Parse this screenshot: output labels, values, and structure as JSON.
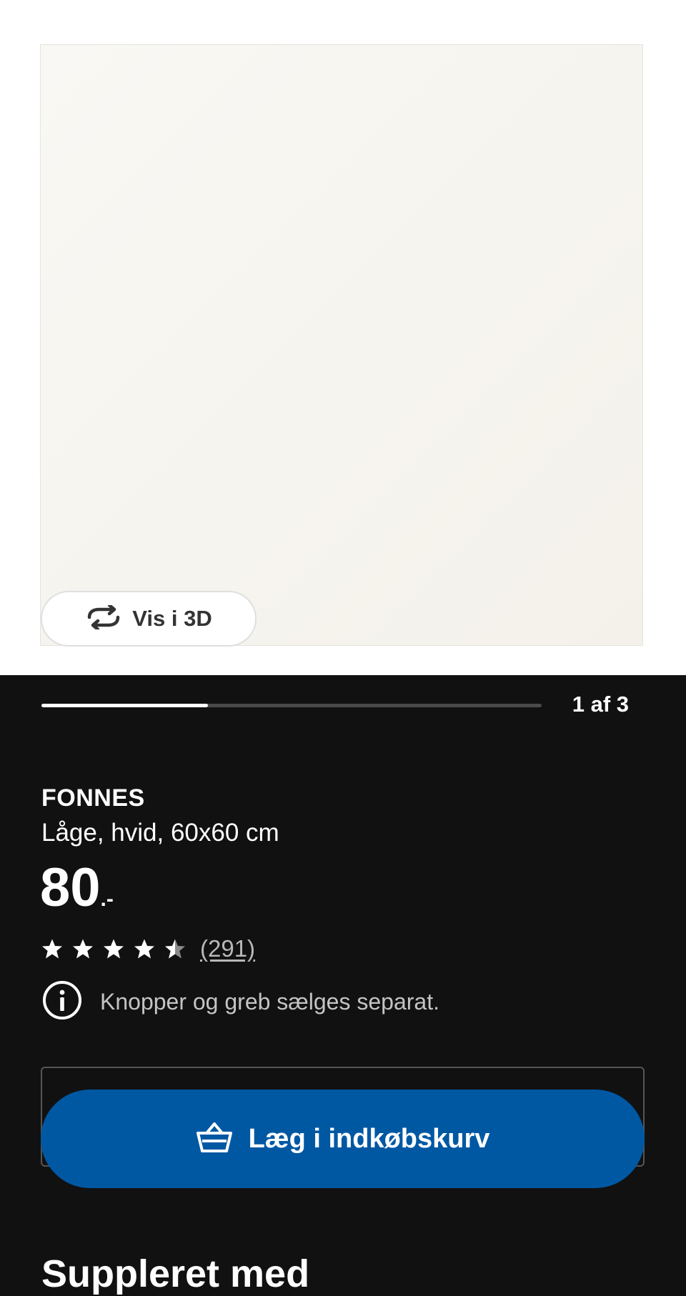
{
  "gallery": {
    "view_3d_label": "Vis i 3D",
    "progress": 0.333,
    "page_counter": "1 af 3"
  },
  "product": {
    "name": "FONNES",
    "description": "Låge, hvid, 60x60 cm",
    "price_integer": "80",
    "price_suffix": ".-",
    "rating": 4.5,
    "rating_max": 5,
    "review_count": "(291)",
    "notice": "Knopper og greb sælges separat."
  },
  "actions": {
    "add_to_cart_label": "Læg i indkøbskurv"
  },
  "sections": {
    "complemented_with": "Suppleret med"
  },
  "colors": {
    "background": "#111111",
    "primary_button": "#0058a3",
    "star_filled": "#ffffff",
    "star_empty": "#8a8a8a"
  },
  "icons": {
    "view_3d": "rotate-3d-icon",
    "info": "info-circle-icon",
    "cart": "shopping-basket-icon",
    "star": "star-icon"
  }
}
